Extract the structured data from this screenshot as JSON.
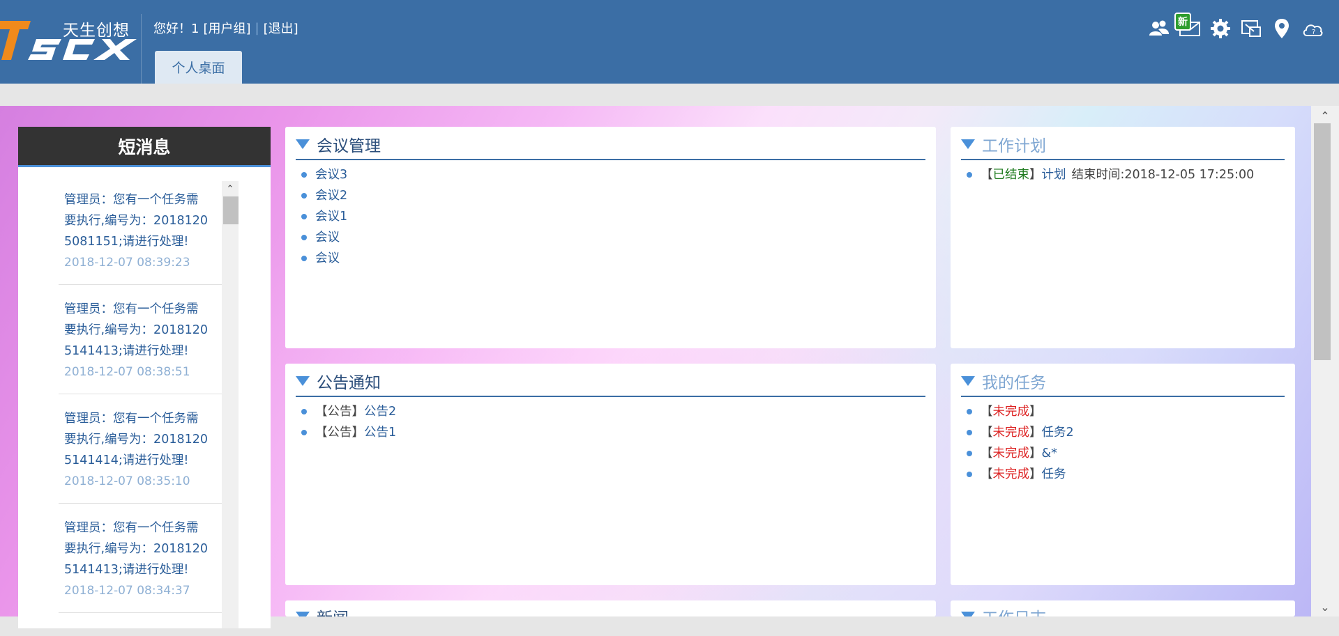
{
  "header": {
    "logo_text": "TSCX",
    "logo_tagline": "天生创想",
    "greeting": "您好！1",
    "user_group": "[用户组]",
    "logout": "[退出]",
    "tab": "个人桌面",
    "new_badge": "新",
    "toolbar_icons": [
      "users-icon",
      "mail-icon",
      "gear-icon",
      "window-icon",
      "location-pin-icon",
      "cloud-help-icon"
    ]
  },
  "messages": {
    "title": "短消息",
    "items": [
      {
        "text": "管理员：您有一个任务需要执行,编号为：20181205081151;请进行处理!",
        "time": "2018-12-07 08:39:23"
      },
      {
        "text": "管理员：您有一个任务需要执行,编号为：20181205141413;请进行处理!",
        "time": "2018-12-07 08:38:51"
      },
      {
        "text": "管理员：您有一个任务需要执行,编号为：20181205141414;请进行处理!",
        "time": "2018-12-07 08:35:10"
      },
      {
        "text": "管理员：您有一个任务需要执行,编号为：20181205141413;请进行处理!",
        "time": "2018-12-07 08:34:37"
      }
    ]
  },
  "meeting": {
    "title": "会议管理",
    "items": [
      "会议3",
      "会议2",
      "会议1",
      "会议",
      "会议"
    ]
  },
  "plan": {
    "title": "工作计划",
    "items": [
      {
        "open": "【",
        "status": "已结束",
        "close": "】",
        "name": "计划",
        "extra": "结束时间:2018-12-05 17:25:00"
      }
    ]
  },
  "notice": {
    "title": "公告通知",
    "items": [
      {
        "tag": "【公告】",
        "name": "公告2"
      },
      {
        "tag": "【公告】",
        "name": "公告1"
      }
    ]
  },
  "tasks": {
    "title": "我的任务",
    "items": [
      {
        "open": "【",
        "status": "未完成",
        "close": "】",
        "name": ""
      },
      {
        "open": "【",
        "status": "未完成",
        "close": "】",
        "name": "任务2"
      },
      {
        "open": "【",
        "status": "未完成",
        "close": "】",
        "name": "&*"
      },
      {
        "open": "【",
        "status": "未完成",
        "close": "】",
        "name": "任务"
      }
    ]
  },
  "news": {
    "title": "新闻"
  },
  "daily": {
    "title": "工作日志"
  },
  "colors": {
    "header": "#3b6ea5",
    "accent": "#4a90d9",
    "status_done": "#1c7a1c",
    "status_pending": "#dd2222"
  }
}
